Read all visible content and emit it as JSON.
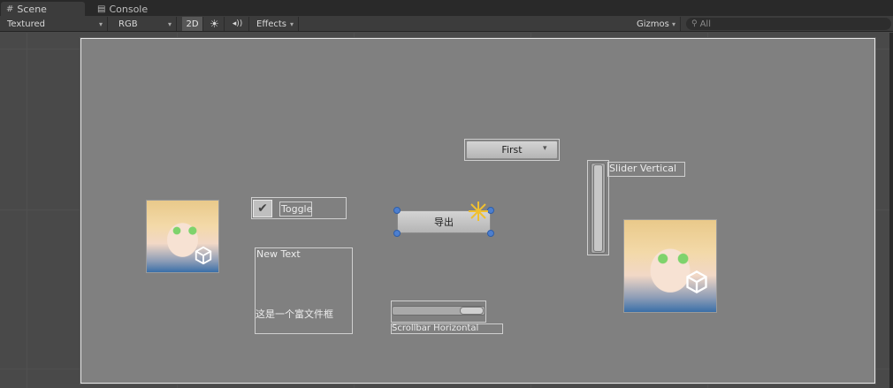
{
  "tabs": [
    {
      "label": "Scene",
      "icon": "scene-grid-icon"
    },
    {
      "label": "Console",
      "icon": "console-icon"
    }
  ],
  "toolbar": {
    "shading_mode": "Textured",
    "render_mode": "RGB",
    "mode_2d": "2D",
    "effects": "Effects",
    "gizmos": "Gizmos",
    "search_placeholder": "All"
  },
  "scene": {
    "dropdown_label": "First",
    "toggle_label": "Toggle",
    "button_label": "导出",
    "slider_label": "Slider Vertical",
    "text_label": "New Text",
    "rich_text": "这是一个富文件框",
    "scrollbar_label": "Scrollbar Horizontal"
  },
  "colors": {
    "canvas": "#808080",
    "viewport_bg": "#494949",
    "selection_handle": "#4d7fcf",
    "toolbar_bg": "#3c3c3c"
  }
}
